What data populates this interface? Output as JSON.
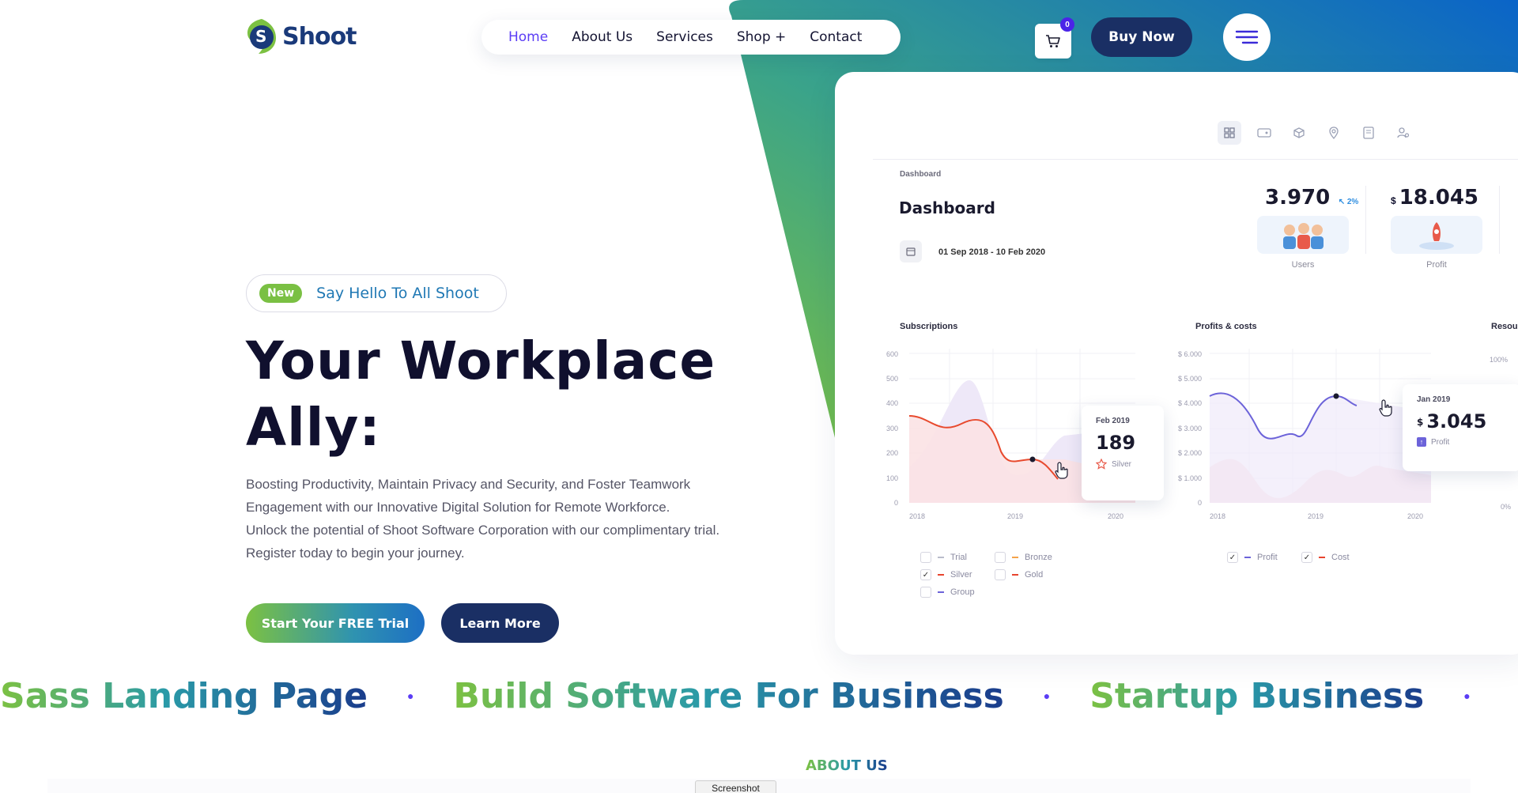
{
  "brand": {
    "name": "Shoot",
    "logo_letter": "S"
  },
  "nav": {
    "items": [
      {
        "label": "Home",
        "active": true
      },
      {
        "label": "About Us",
        "active": false
      },
      {
        "label": "Services",
        "active": false
      },
      {
        "label": "Shop +",
        "active": false
      },
      {
        "label": "Contact",
        "active": false
      }
    ]
  },
  "header": {
    "cart_count": "0",
    "buy_label": "Buy Now",
    "cart_icon": "cart-icon",
    "menu_icon": "hamburger-icon"
  },
  "hero": {
    "badge_new": "New",
    "badge_text": "Say Hello To All Shoot",
    "title_line1": "Your Workplace",
    "title_line2": "Ally:",
    "desc_line1": "Boosting Productivity, Maintain Privacy and Security, and Foster Teamwork",
    "desc_line2": "Engagement with our Innovative Digital Solution for Remote Workforce.",
    "desc_line3": "Unlock the potential of Shoot Software Corporation with our complimentary trial.",
    "desc_line4": "Register today to begin your journey.",
    "cta_primary": "Start Your FREE Trial",
    "cta_secondary": "Learn More"
  },
  "dashboard": {
    "breadcrumb": "Dashboard",
    "title": "Dashboard",
    "date_range": "01 Sep 2018 - 10 Feb 2020",
    "stats": [
      {
        "value": "3.970",
        "currency": "",
        "delta": "2%",
        "label": "Users"
      },
      {
        "value": "18.045",
        "currency": "$",
        "delta": "",
        "label": "Profit"
      }
    ],
    "subscriptions": {
      "title": "Subscriptions",
      "y_ticks": [
        "600",
        "500",
        "400",
        "300",
        "200",
        "100",
        "0"
      ],
      "x_ticks": [
        "2018",
        "2019",
        "2020"
      ],
      "tooltip": {
        "date": "Feb 2019",
        "value": "189",
        "label": "Silver"
      },
      "legend": [
        {
          "label": "Trial",
          "checked": false,
          "color": "#b9bccb"
        },
        {
          "label": "Bronze",
          "checked": false,
          "color": "#f5a34a"
        },
        {
          "label": "Silver",
          "checked": true,
          "color": "#e8442e"
        },
        {
          "label": "Gold",
          "checked": false,
          "color": "#e8442e"
        },
        {
          "label": "Group",
          "checked": false,
          "color": "#6c63d9"
        }
      ]
    },
    "profits": {
      "title": "Profits & costs",
      "y_ticks": [
        "$ 6.000",
        "$ 5.000",
        "$ 4.000",
        "$ 3.000",
        "$ 2.000",
        "$ 1.000",
        "0"
      ],
      "x_ticks": [
        "2018",
        "2019",
        "2020"
      ],
      "tooltip": {
        "date": "Jan 2019",
        "currency": "$",
        "value": "3.045",
        "label": "Profit"
      },
      "legend": [
        {
          "label": "Profit",
          "checked": true,
          "color": "#6c63d9"
        },
        {
          "label": "Cost",
          "checked": true,
          "color": "#e8442e"
        }
      ]
    },
    "resources": {
      "title": "Resou",
      "y_ticks": [
        "100%",
        "0%"
      ]
    }
  },
  "marquee": [
    "Sass Landing Page",
    "Build Software For Business",
    "Startup Business"
  ],
  "about": {
    "eyebrow": "ABOUT US"
  },
  "overlay": {
    "screenshot_label": "Screenshot"
  },
  "colors": {
    "accent": "#5b3df5",
    "navy": "#1a2f64",
    "green": "#7cc142",
    "blue": "#1d6fc4"
  }
}
